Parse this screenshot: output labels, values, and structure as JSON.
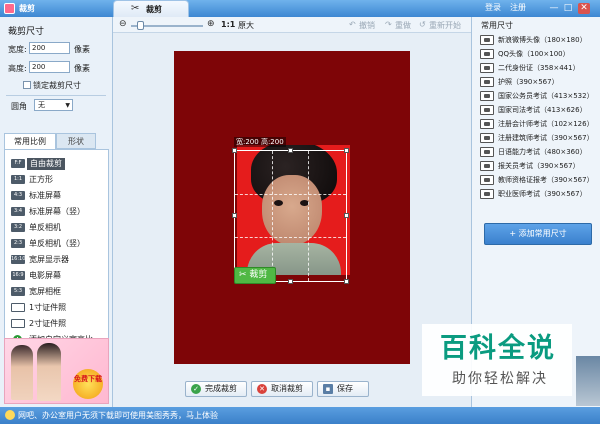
{
  "titlebar": {
    "app_title": "裁剪",
    "tab_label": "裁剪",
    "login": "登录",
    "register": "注册",
    "min_symbol": "—",
    "max_symbol": "□",
    "close_symbol": "✕"
  },
  "left": {
    "title": "裁剪尺寸",
    "width_label": "宽度:",
    "width_value": "200",
    "height_label": "高度:",
    "height_value": "200",
    "unit": "像素",
    "lock_label": "锁定裁剪尺寸",
    "corner_label": "圆角",
    "corner_value": "无",
    "tab_ratio": "常用比例",
    "tab_shape": "形状",
    "ratios": [
      {
        "icon": "F:F",
        "label": "自由裁剪"
      },
      {
        "icon": "1:1",
        "label": "正方形"
      },
      {
        "icon": "4:3",
        "label": "标准屏幕"
      },
      {
        "icon": "3:4",
        "label": "标准屏幕（竖）"
      },
      {
        "icon": "3:2",
        "label": "单反相机"
      },
      {
        "icon": "2:3",
        "label": "单反相机（竖）"
      },
      {
        "icon": "16:10",
        "label": "宽屏显示器"
      },
      {
        "icon": "16:9",
        "label": "电影屏幕"
      },
      {
        "icon": "5:3",
        "label": "宽屏相框"
      },
      {
        "icon": "",
        "label": "1寸证件照"
      },
      {
        "icon": "",
        "label": "2寸证件照"
      },
      {
        "icon": "+",
        "label": "添加自定义宽高比"
      }
    ],
    "ad_badge": "免费下载"
  },
  "center": {
    "zoom_11": "1:1",
    "zoom_fit": "原大",
    "undo": "撤销",
    "redo": "重做",
    "reset": "重新开始",
    "dim_label": "宽:200 高:200",
    "crop_button": "裁剪",
    "complete_button": "完成裁剪",
    "cancel_button": "取消裁剪",
    "save_button": "保存"
  },
  "right": {
    "title": "常用尺寸",
    "sizes": [
      "新浪微博头像（180×180）",
      "QQ头像（100×100）",
      "二代身份证（358×441）",
      "护照（390×567）",
      "国家公务员考试（413×532）",
      "国家司法考试（413×626）",
      "注册会计师考试（102×126）",
      "注册建筑师考试（390×567）",
      "日语能力考试（480×360）",
      "报关员考试（390×567）",
      "教师资格证报考（390×567）",
      "职业医师考试（390×567）"
    ],
    "add_button": "+ 添加常用尺寸"
  },
  "watermark": {
    "main": "百科全说",
    "sub": "助你轻松解决"
  },
  "status": {
    "text": "网吧、办公室用户无须下载即可使用美图秀秀，马上体验"
  },
  "colors": {
    "canvas": "#7e0507",
    "photo_bg": "#e51c1c",
    "crop_btn": "#50b844",
    "accent": "#3a80cd"
  }
}
